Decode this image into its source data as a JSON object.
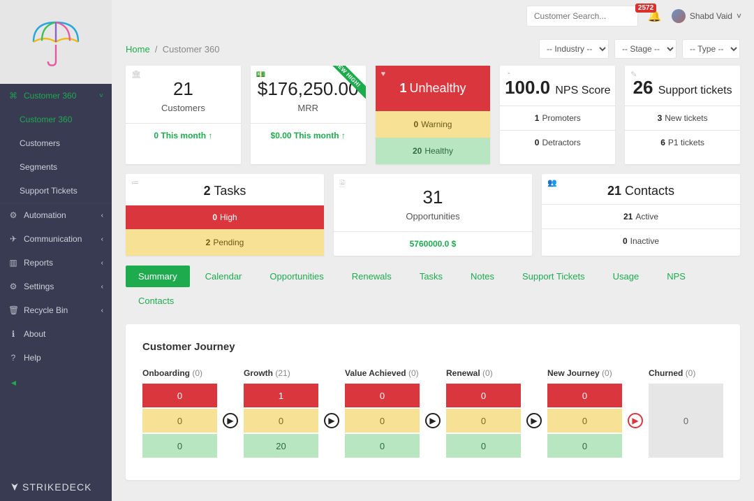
{
  "topbar": {
    "search_placeholder": "Customer Search...",
    "notif_count": "2572",
    "user_name": "Shabd Vaid"
  },
  "breadcrumb": {
    "home": "Home",
    "sep": "/",
    "current": "Customer 360"
  },
  "filters": {
    "industry": "-- Industry --",
    "stage": "-- Stage --",
    "type": "-- Type --"
  },
  "sidebar": {
    "brand": "STRIKEDECK",
    "items": [
      {
        "icon": "⌘",
        "label": "Customer 360",
        "active": true,
        "caret": "˅"
      },
      {
        "icon": "⚙",
        "label": "Automation",
        "caret": "‹"
      },
      {
        "icon": "✈",
        "label": "Communication",
        "caret": "‹"
      },
      {
        "icon": "▥",
        "label": "Reports",
        "caret": "‹"
      },
      {
        "icon": "⚙",
        "label": "Settings",
        "caret": "‹"
      },
      {
        "icon": "🗑",
        "label": "Recycle Bin",
        "caret": "‹"
      },
      {
        "icon": "ℹ",
        "label": "About"
      },
      {
        "icon": "?",
        "label": "Help"
      }
    ],
    "sub": [
      "Customer 360",
      "Customers",
      "Segments",
      "Support Tickets"
    ]
  },
  "stats": {
    "customers": {
      "value": "21",
      "label": "Customers",
      "foot": "0 This month ↑"
    },
    "mrr": {
      "value": "$176,250.00",
      "label": "MRR",
      "foot": "$0.00 This month ↑",
      "ribbon": "NEW HIGH!"
    },
    "health": {
      "unhealthy_n": "1",
      "unhealthy_l": "Unhealthy",
      "warn_n": "0",
      "warn_l": "Warning",
      "healthy_n": "20",
      "healthy_l": "Healthy"
    },
    "nps": {
      "value": "100.0",
      "label": "NPS Score",
      "row1_n": "1",
      "row1_l": "Promoters",
      "row2_n": "0",
      "row2_l": "Detractors"
    },
    "tickets": {
      "value": "26",
      "label": "Support tickets",
      "row1_n": "3",
      "row1_l": "New tickets",
      "row2_n": "6",
      "row2_l": "P1 tickets"
    },
    "tasks": {
      "value": "2",
      "label": "Tasks",
      "high_n": "0",
      "high_l": "High",
      "pend_n": "2",
      "pend_l": "Pending"
    },
    "opps": {
      "value": "31",
      "label": "Opportunities",
      "total": "5760000.0 $"
    },
    "contacts": {
      "value": "21",
      "label": "Contacts",
      "row1_n": "21",
      "row1_l": "Active",
      "row2_n": "0",
      "row2_l": "Inactive"
    }
  },
  "tabs": [
    "Summary",
    "Calendar",
    "Opportunities",
    "Renewals",
    "Tasks",
    "Notes",
    "Support Tickets",
    "Usage",
    "NPS",
    "Contacts"
  ],
  "journey": {
    "title": "Customer Journey",
    "stages": [
      {
        "name": "Onboarding",
        "count": "(0)",
        "r": "0",
        "y": "0",
        "g": "0"
      },
      {
        "name": "Growth",
        "count": "(21)",
        "r": "1",
        "y": "0",
        "g": "20"
      },
      {
        "name": "Value Achieved",
        "count": "(0)",
        "r": "0",
        "y": "0",
        "g": "0"
      },
      {
        "name": "Renewal",
        "count": "(0)",
        "r": "0",
        "y": "0",
        "g": "0"
      },
      {
        "name": "New Journey",
        "count": "(0)",
        "r": "0",
        "y": "0",
        "g": "0"
      }
    ],
    "churned": {
      "name": "Churned",
      "count": "(0)",
      "val": "0"
    }
  }
}
